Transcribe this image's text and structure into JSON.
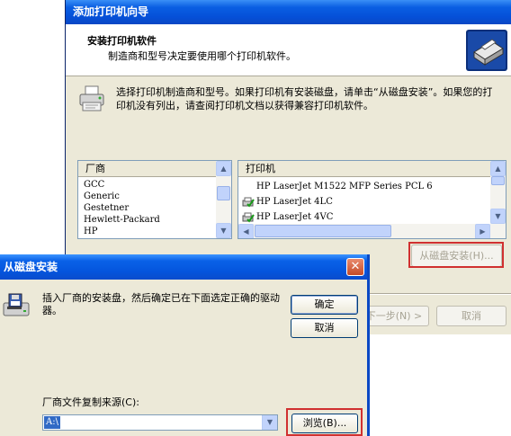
{
  "wizard": {
    "title": "添加打印机向导",
    "header_title": "安装打印机软件",
    "header_subtitle": "制造商和型号决定要使用哪个打印机软件。",
    "instruction": "选择打印机制造商和型号。如果打印机有安装磁盘，请单击“从磁盘安装”。如果您的打印机没有列出，请查阅打印机文档以获得兼容打印机软件。",
    "manufacturers_header": "厂商",
    "manufacturers": [
      "GCC",
      "Generic",
      "Gestetner",
      "Hewlett-Packard",
      "HP"
    ],
    "printers_header": "打印机",
    "printers": [
      {
        "name": "HP LaserJet M1522 MFP Series PCL 6",
        "icon": "none"
      },
      {
        "name": "HP LaserJet 4LC",
        "icon": "certified-driver-icon"
      },
      {
        "name": "HP LaserJet 4VC",
        "icon": "certified-driver-icon"
      }
    ],
    "have_disk_label": "从磁盘安装(H)...",
    "next_label": "下一步(N) >",
    "cancel_label": "取消"
  },
  "disk_dialog": {
    "title": "从磁盘安装",
    "close_icon": "close-icon",
    "message": "插入厂商的安装盘，然后确定已在下面选定正确的驱动器。",
    "ok_label": "确定",
    "cancel_label": "取消",
    "copy_from_label": "厂商文件复制来源(C):",
    "copy_from_value": "A:\\",
    "browse_label": "浏览(B)..."
  },
  "colors": {
    "titlebar": "#0a5ee2",
    "dialog_bg": "#ece9d8",
    "highlight_box": "#d03030",
    "selection": "#316ac5"
  }
}
